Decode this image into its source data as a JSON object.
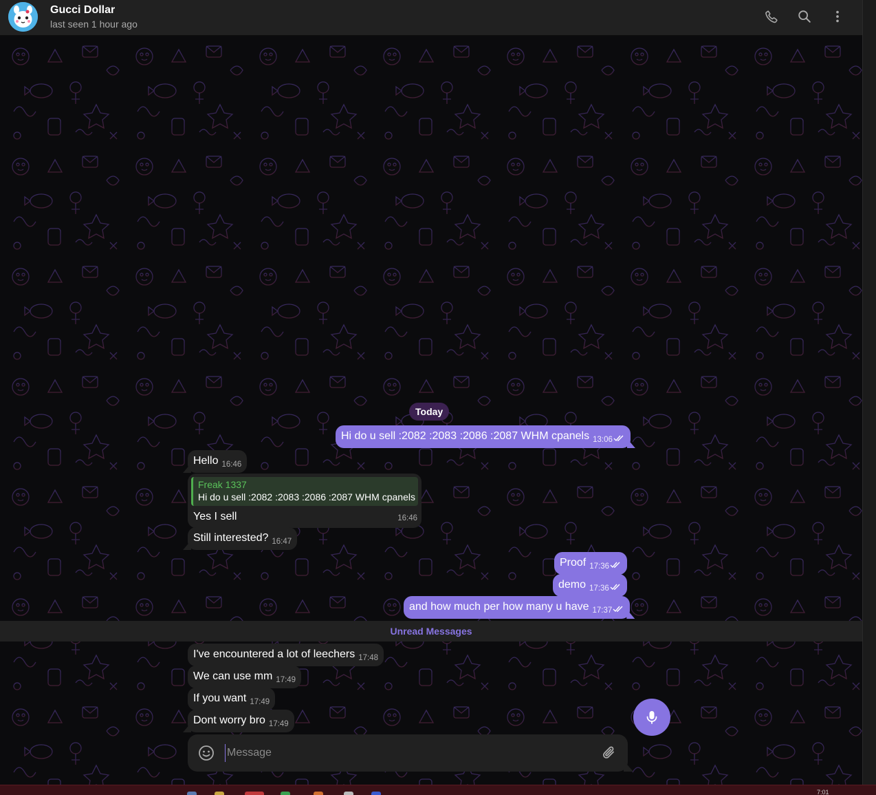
{
  "header": {
    "name": "Gucci Dollar",
    "status": "last seen 1 hour ago"
  },
  "date_pill": "Today",
  "messages": [
    {
      "dir": "out",
      "text": "Hi do u sell :2082 :2083 :2086 :2087 WHM cpanels",
      "time": "13:06"
    },
    {
      "dir": "in",
      "text": "Hello",
      "time": "16:46"
    },
    {
      "dir": "in",
      "reply_name": "Freak 1337",
      "reply_text": "Hi do u sell :2082 :2083 :2086 :2087 WHM cpanels",
      "text": "Yes I sell",
      "time": "16:46"
    },
    {
      "dir": "in",
      "text": "Still interested?",
      "time": "16:47"
    },
    {
      "dir": "out",
      "text": "Proof",
      "time": "17:36"
    },
    {
      "dir": "out",
      "text": "demo",
      "time": "17:36"
    },
    {
      "dir": "out",
      "text": "and how much per how many u have",
      "time": "17:37"
    },
    {
      "dir": "in",
      "text": "I've encountered a lot of leechers",
      "time": "17:48"
    },
    {
      "dir": "in",
      "text": "We can use mm",
      "time": "17:49"
    },
    {
      "dir": "in",
      "text": "If you want",
      "time": "17:49"
    },
    {
      "dir": "in",
      "text": "Dont worry bro",
      "time": "17:49"
    }
  ],
  "unread_label": "Unread Messages",
  "composer": {
    "placeholder": "Message"
  },
  "taskbar": {
    "time": "7:01"
  },
  "colors": {
    "accent": "#8774e1",
    "incoming_bubble": "#212121",
    "header_bg": "#212121",
    "reply_accent": "#4fae4e"
  },
  "icons": [
    "phone-icon",
    "search-icon",
    "more-vertical-icon",
    "emoji-icon",
    "paperclip-icon",
    "microphone-icon",
    "double-check-icon"
  ]
}
